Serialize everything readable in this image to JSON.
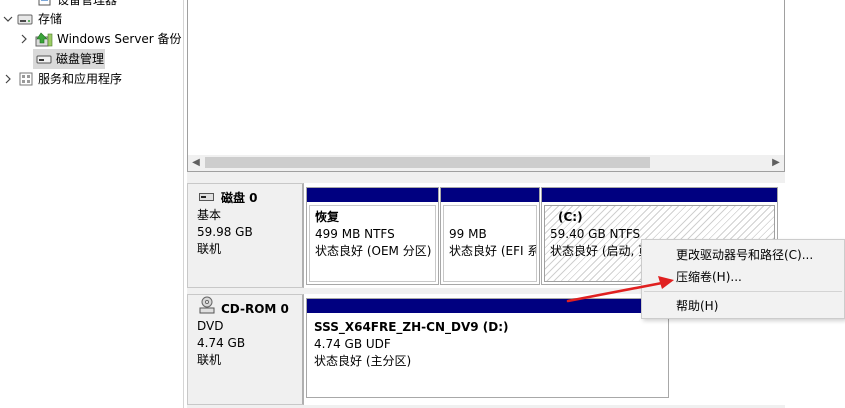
{
  "tree": {
    "items": [
      {
        "label": "设备管理器",
        "icon": "device-manager-icon"
      },
      {
        "label": "存储",
        "icon": "storage-icon"
      },
      {
        "label": "Windows Server 备份",
        "icon": "windows-server-backup-icon"
      },
      {
        "label": "磁盘管理",
        "icon": "disk-management-icon"
      },
      {
        "label": "服务和应用程序",
        "icon": "services-apps-icon"
      }
    ]
  },
  "disks": [
    {
      "name": "磁盘 0",
      "type": "基本",
      "size": "59.98 GB",
      "status": "联机",
      "volumes": [
        {
          "name": "恢复",
          "size": "499 MB NTFS",
          "status": "状态良好 (OEM 分区)"
        },
        {
          "name": "",
          "size": "99 MB",
          "status": "状态良好 (EFI 系"
        },
        {
          "name": "(C:)",
          "size": "59.40 GB NTFS",
          "status": "状态良好 (启动, 页"
        }
      ]
    },
    {
      "name": "CD-ROM 0",
      "type": "DVD",
      "size": "4.74 GB",
      "status": "联机",
      "volumes": [
        {
          "name": "SSS_X64FRE_ZH-CN_DV9  (D:)",
          "size": "4.74 GB UDF",
          "status": "状态良好 (主分区)"
        }
      ]
    }
  ],
  "context_menu": {
    "items": [
      "更改驱动器号和路径(C)...",
      "压缩卷(H)...",
      "帮助(H)"
    ],
    "highlighted": "压缩卷(H)..."
  },
  "colors": {
    "volume_bar": "#000080",
    "annotation_arrow": "#e02020"
  }
}
